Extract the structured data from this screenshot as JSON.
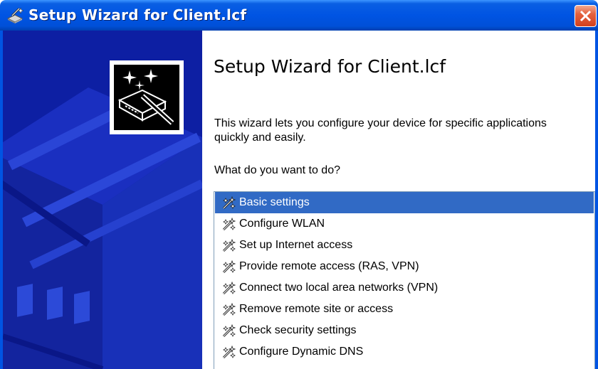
{
  "window": {
    "title": "Setup Wizard for Client.lcf"
  },
  "main": {
    "heading": "Setup Wizard for Client.lcf",
    "description": "This wizard lets you configure your device for specific applications quickly and easily.",
    "prompt": "What do you want to do?",
    "options": [
      {
        "label": "Basic settings",
        "selected": true
      },
      {
        "label": "Configure WLAN",
        "selected": false
      },
      {
        "label": "Set up Internet access",
        "selected": false
      },
      {
        "label": "Provide remote access (RAS, VPN)",
        "selected": false
      },
      {
        "label": "Connect two local area networks (VPN)",
        "selected": false
      },
      {
        "label": "Remove remote site or access",
        "selected": false
      },
      {
        "label": "Check security settings",
        "selected": false
      },
      {
        "label": "Configure Dynamic DNS",
        "selected": false
      }
    ],
    "item_icon": "wizard-wand-icon"
  },
  "colors": {
    "titlebar": "#0054e3",
    "side_panel": "#0d1fa3",
    "selection": "#316ac5",
    "close_button": "#e04f2c"
  }
}
